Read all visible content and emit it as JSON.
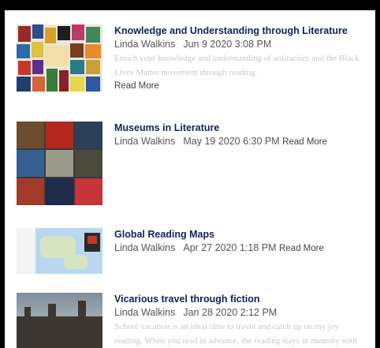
{
  "posts": [
    {
      "title": "Knowledge and Understanding through Literature",
      "author": "Linda Walkins",
      "date": "Jun 9 2020 3:08 PM",
      "excerpt_1": "Enrich your knowledge and understanding of antiracism and the Black",
      "excerpt_2": "Lives Matter movement through reading.",
      "read_more": "Read More"
    },
    {
      "title": "Museums in Literature",
      "author": "Linda Walkins",
      "date": "May 19 2020 6:30 PM",
      "read_more": "Read More"
    },
    {
      "title": "Global Reading Maps",
      "author": "Linda Walkins",
      "date": "Apr 27 2020 1:18 PM",
      "read_more": "Read More"
    },
    {
      "title": "Vicarious travel through fiction",
      "author": "Linda Walkins",
      "date": "Jan 28 2020 2:12 PM",
      "excerpt_1": "School vacation is an ideal time to travel and catch up on my joy",
      "excerpt_2": "reading. When you read in advance, the reading stays in memory with"
    }
  ],
  "colors": {
    "title": "#13215a",
    "meta": "#555555",
    "excerpt": "#c9c9c9",
    "background": "#ffffff",
    "frame": "#000000"
  }
}
